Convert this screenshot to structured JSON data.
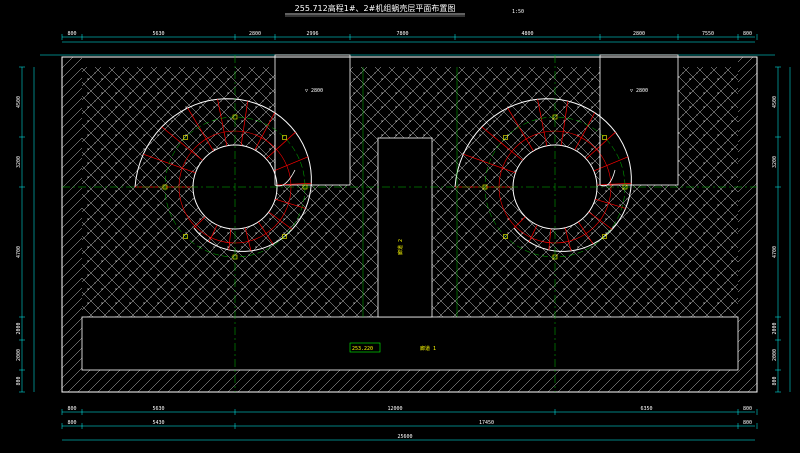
{
  "title": "255.712高程1#、2#机组蜗壳层平面布置图",
  "scale": "1:50",
  "top_dims": [
    "800",
    "5630",
    "2800",
    "2996",
    "7800",
    "4800",
    "2800",
    "7550",
    "800"
  ],
  "bottom_dims_1": [
    "800",
    "5630",
    "12000",
    "6350",
    "800"
  ],
  "bottom_dims_2": [
    "800",
    "5430",
    "17450",
    "800"
  ],
  "total_dim": "25600",
  "left_dims": [
    "4500",
    "3200",
    "4700",
    "2000",
    "2000",
    "800"
  ],
  "right_dims": [
    "4500",
    "3200",
    "4700",
    "2000",
    "2000",
    "800"
  ],
  "elevation_box": "253.220",
  "corridor_label": "廊道 1",
  "shaft_label": "廊道 2",
  "spiral_label_left": "▽ 2800",
  "spiral_label_right": "▽ 2800",
  "colors": {
    "background": "#000000",
    "outline": "#ffffff",
    "spiral": "#ff0000",
    "centerline": "#00c000",
    "marker": "#ffff00",
    "dimension": "#00ffff",
    "hatch": "#ffffff",
    "label_box": "#00ff00"
  }
}
